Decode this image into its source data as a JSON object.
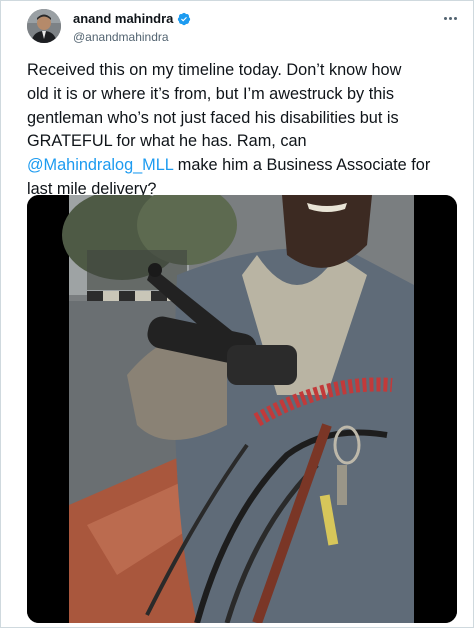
{
  "author": {
    "name": "anand mahindra",
    "handle": "@anandmahindra",
    "verified": true
  },
  "tweet": {
    "lines": [
      "Received this on my timeline today. Don’t know how",
      "old it is or where it’s from, but I’m awestruck by this",
      "gentleman who’s not just faced his disabilities but is",
      "GRATEFUL for what he has. Ram, can"
    ],
    "mention": "@Mahindralog_MLL",
    "line5_rest": " make him a Business Associate for",
    "line6": "last mile delivery?"
  },
  "colors": {
    "text": "#0f1419",
    "secondary": "#536471",
    "link": "#1d9bf0",
    "verified_badge": "#1d9bf0"
  },
  "icons": {
    "verified": "verified-badge-icon",
    "more": "more-options-icon"
  }
}
